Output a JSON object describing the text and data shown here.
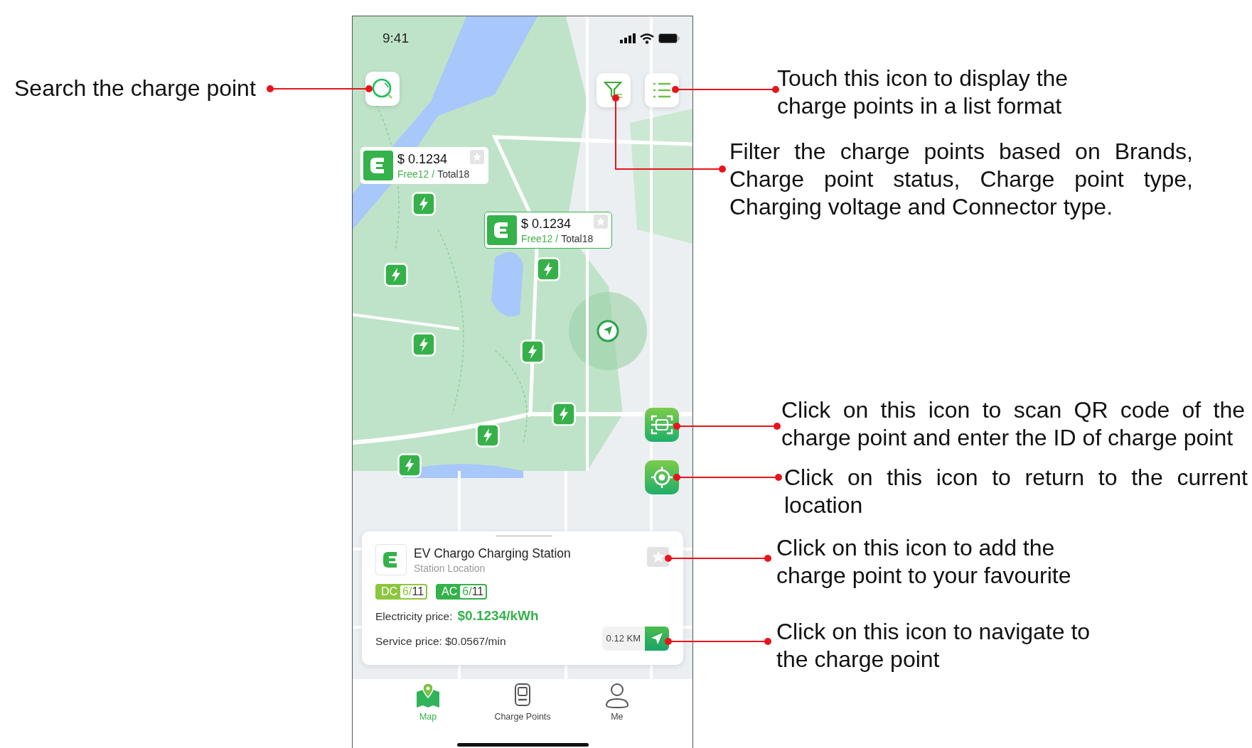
{
  "status_bar": {
    "time": "9:41"
  },
  "map": {
    "price_markers": [
      {
        "price": "$ 0.1234",
        "free": "Free12 /",
        "total": "Total18",
        "favourite": false
      },
      {
        "price": "$ 0.1234",
        "free": "Free12 /",
        "total": "Total18",
        "favourite": false
      }
    ]
  },
  "station_card": {
    "name": "EV Chargo Charging Station",
    "subtitle": "Station Location",
    "favourite": false,
    "connectors": [
      {
        "type": "DC",
        "free": "6/",
        "total": "11",
        "color": "#8cc63f"
      },
      {
        "type": "AC",
        "free": "6/",
        "total": "11",
        "color": "#35b24a"
      }
    ],
    "electricity_label": "Electricity price:",
    "electricity_price": "$0.1234/kWh",
    "service_price": "Service price: $0.0567/min",
    "distance": "0.12 KM"
  },
  "tabs": [
    {
      "label": "Map",
      "selected": true
    },
    {
      "label": "Charge Points",
      "selected": false
    },
    {
      "label": "Me",
      "selected": false
    }
  ],
  "annotations": [
    {
      "text": "Search the charge point"
    },
    {
      "text": "Touch this icon to display the charge points in a list format"
    },
    {
      "text": "Filter the charge points based on Brands, Charge point status, Charge point type, Charging voltage and Connector type."
    },
    {
      "text": "Click on this icon to scan QR code of the charge point and enter the ID of charge point"
    },
    {
      "text": "Click on this icon to return to the current location"
    },
    {
      "text": "Click on this icon to add the charge point to your favourite"
    },
    {
      "text": "Click on this icon to navigate to the charge point"
    }
  ]
}
